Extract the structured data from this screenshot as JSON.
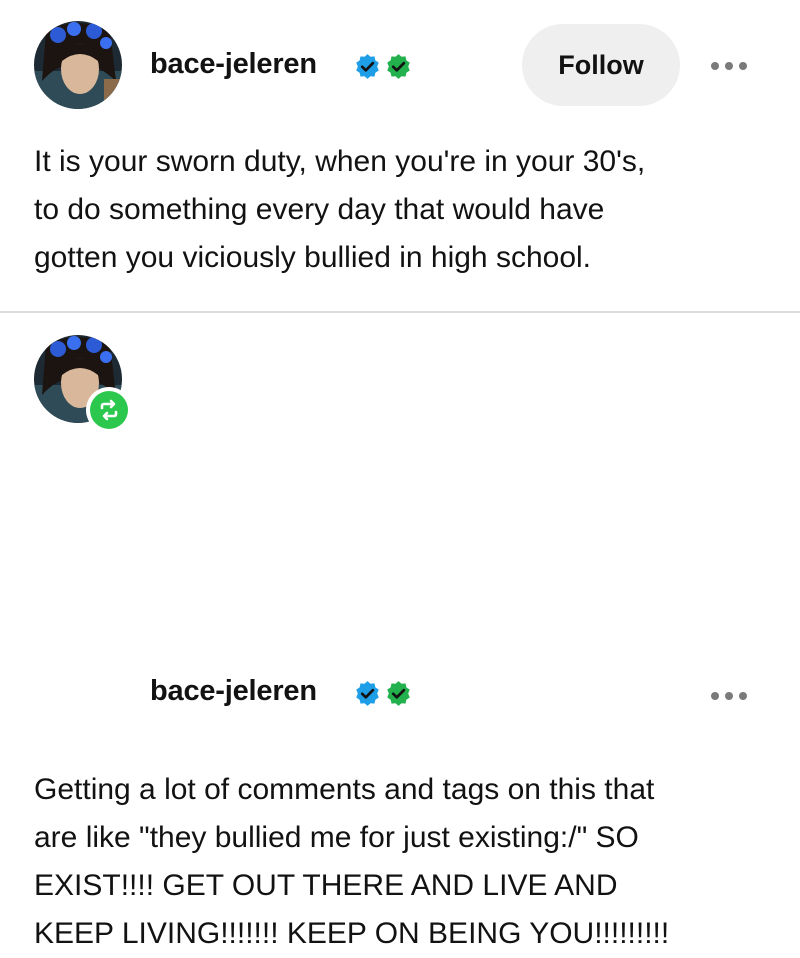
{
  "post1": {
    "username": "bace-jeleren",
    "follow_label": "Follow",
    "body_lines": [
      "It is your sworn duty, when you're in your 30's,",
      "to do something every day that would have",
      "gotten you viciously bullied in high school."
    ]
  },
  "post2": {
    "username": "bace-jeleren",
    "body_lines": [
      "Getting a lot of comments and tags on this that",
      "are like \"they bullied me for just existing:/\" SO",
      "EXIST!!!! GET OUT THERE AND LIVE AND",
      "KEEP LIVING!!!!!!! KEEP ON BEING YOU!!!!!!!!!"
    ]
  },
  "icons": {
    "verified_blue": "verified-blue-badge-icon",
    "verified_green": "verified-green-badge-icon",
    "more": "more-options-icon",
    "reblog": "reblog-icon"
  },
  "colors": {
    "verified_blue": "#1f9ee8",
    "verified_green": "#22b14c",
    "reblog_green": "#2cc84d",
    "follow_bg": "#efefef",
    "text": "#121212"
  }
}
